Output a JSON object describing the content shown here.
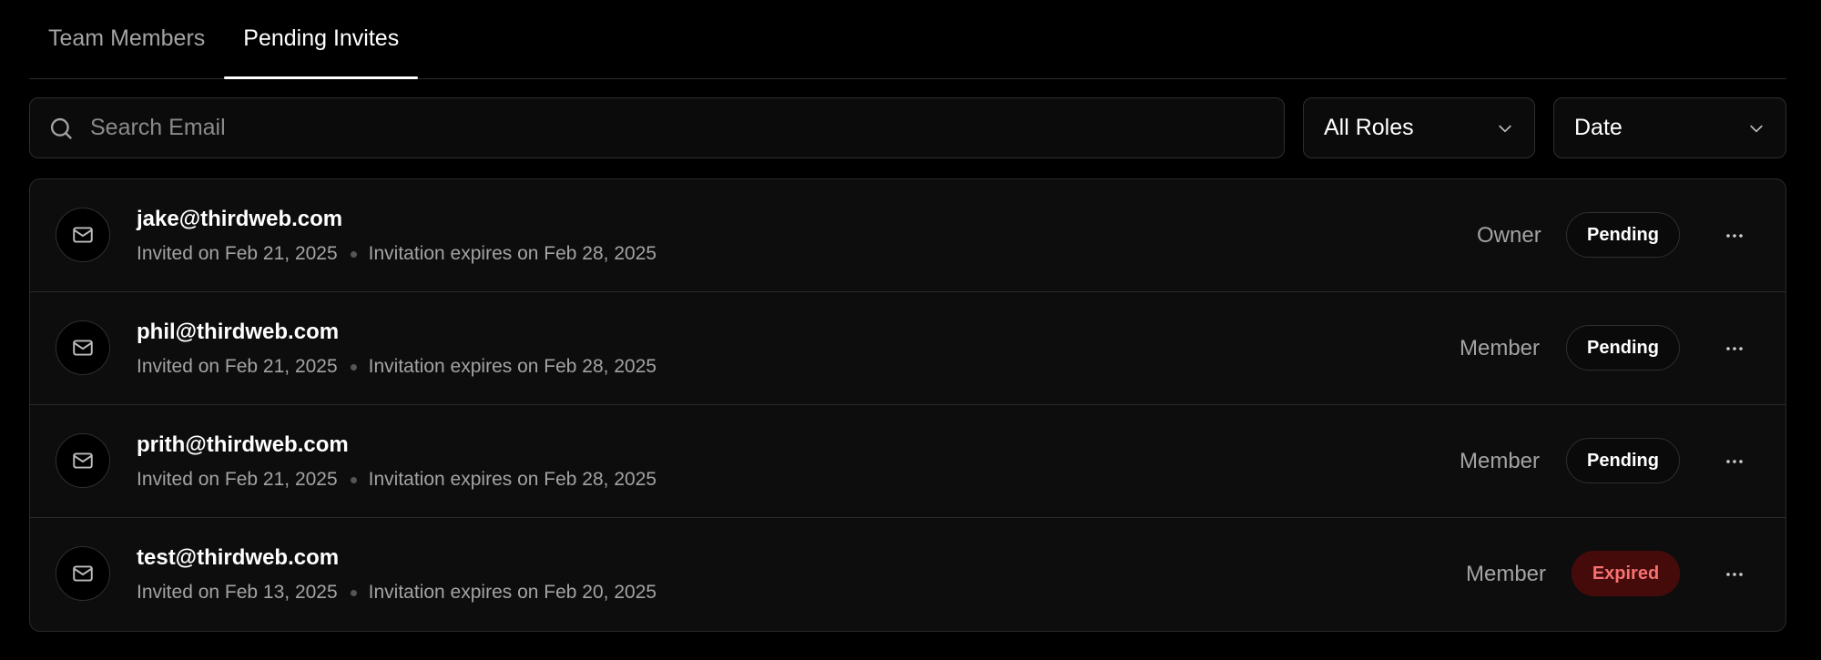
{
  "tabs": [
    {
      "label": "Team Members",
      "active": false
    },
    {
      "label": "Pending Invites",
      "active": true
    }
  ],
  "search": {
    "placeholder": "Search Email",
    "value": ""
  },
  "filters": {
    "role": {
      "selected": "All Roles"
    },
    "sort": {
      "selected": "Date"
    }
  },
  "invites": [
    {
      "email": "jake@thirdweb.com",
      "invited": "Invited on Feb 21, 2025",
      "expires": "Invitation expires on Feb 28, 2025",
      "role": "Owner",
      "status": "Pending"
    },
    {
      "email": "phil@thirdweb.com",
      "invited": "Invited on Feb 21, 2025",
      "expires": "Invitation expires on Feb 28, 2025",
      "role": "Member",
      "status": "Pending"
    },
    {
      "email": "prith@thirdweb.com",
      "invited": "Invited on Feb 21, 2025",
      "expires": "Invitation expires on Feb 28, 2025",
      "role": "Member",
      "status": "Pending"
    },
    {
      "email": "test@thirdweb.com",
      "invited": "Invited on Feb 13, 2025",
      "expires": "Invitation expires on Feb 20, 2025",
      "role": "Member",
      "status": "Expired"
    }
  ],
  "icons": {
    "search": "search-icon",
    "chevron": "chevron-down-icon",
    "mail": "mail-icon",
    "more": "more-horizontal-icon"
  },
  "colors": {
    "background": "#000000",
    "expired_badge_bg": "#450a0a",
    "expired_badge_text": "#f87171",
    "muted_text": "#a3a3a3"
  }
}
